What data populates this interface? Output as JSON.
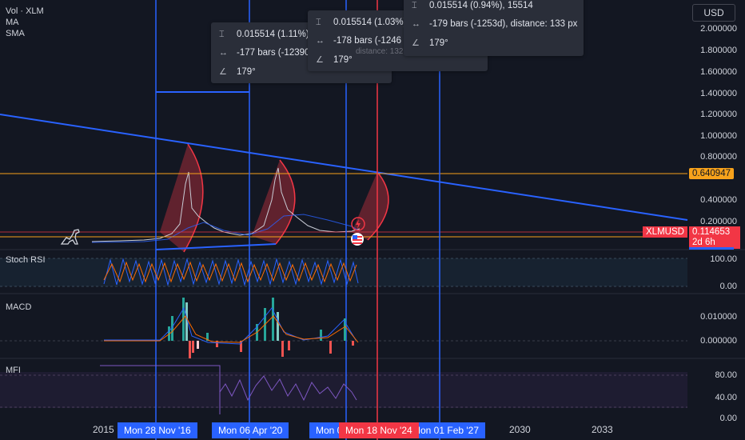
{
  "legend": {
    "vol": "Vol · XLM",
    "ma": "MA",
    "sma": "SMA"
  },
  "currency_button": "USD",
  "price_axis": [
    "2.000000",
    "1.800000",
    "1.600000",
    "1.400000",
    "1.200000",
    "1.000000",
    "0.800000",
    "0.400000",
    "0.200000"
  ],
  "price_tags": {
    "level": "0.640947",
    "symbol": "XLMUSD",
    "current": "0.114653",
    "countdown": "2d 6h"
  },
  "panes": {
    "stoch": {
      "title": "Stoch RSI",
      "ticks": [
        "100.00",
        "0.00"
      ]
    },
    "macd": {
      "title": "MACD",
      "ticks": [
        "0.010000",
        "0.000000"
      ]
    },
    "mfi": {
      "title": "MFI",
      "ticks": [
        "80.00",
        "40.00",
        "0.00"
      ]
    }
  },
  "time_axis": {
    "labels": [
      "2015",
      "2030",
      "2033"
    ],
    "markers": [
      "Mon 28 Nov '16",
      "Mon 06 Apr '20",
      "Mon 0",
      "Mon 18 Nov '24",
      "Mon 01 Feb '27"
    ]
  },
  "tooltips": [
    {
      "change": "0.015514 (1.11%),",
      "bars": "-177 bars (-12390",
      "distance": "distance: 132 px",
      "angle": "179°"
    },
    {
      "change": "0.015514 (1.03%)",
      "bars": "-178 bars (-1246",
      "distance": "distance: 132 px",
      "angle": "179°"
    },
    {
      "change": "0.015514 (0.94%), 15514",
      "bars": "-179 bars (-1253d), distance: 133 px",
      "distance": "",
      "angle": "179°"
    }
  ],
  "colors": {
    "background": "#131722",
    "trendline": "#2962ff",
    "level_line": "#f7a21b",
    "red_line": "#f23645",
    "cycle_fill": "#f23645",
    "stoch_k": "#2962ff",
    "stoch_d": "#ff6d00",
    "mfi_line": "#7e57c2"
  },
  "icons": [
    "price-range-icon",
    "date-range-icon",
    "angle-icon",
    "dinosaur-icon",
    "flash-icon",
    "us-flag-icon"
  ]
}
